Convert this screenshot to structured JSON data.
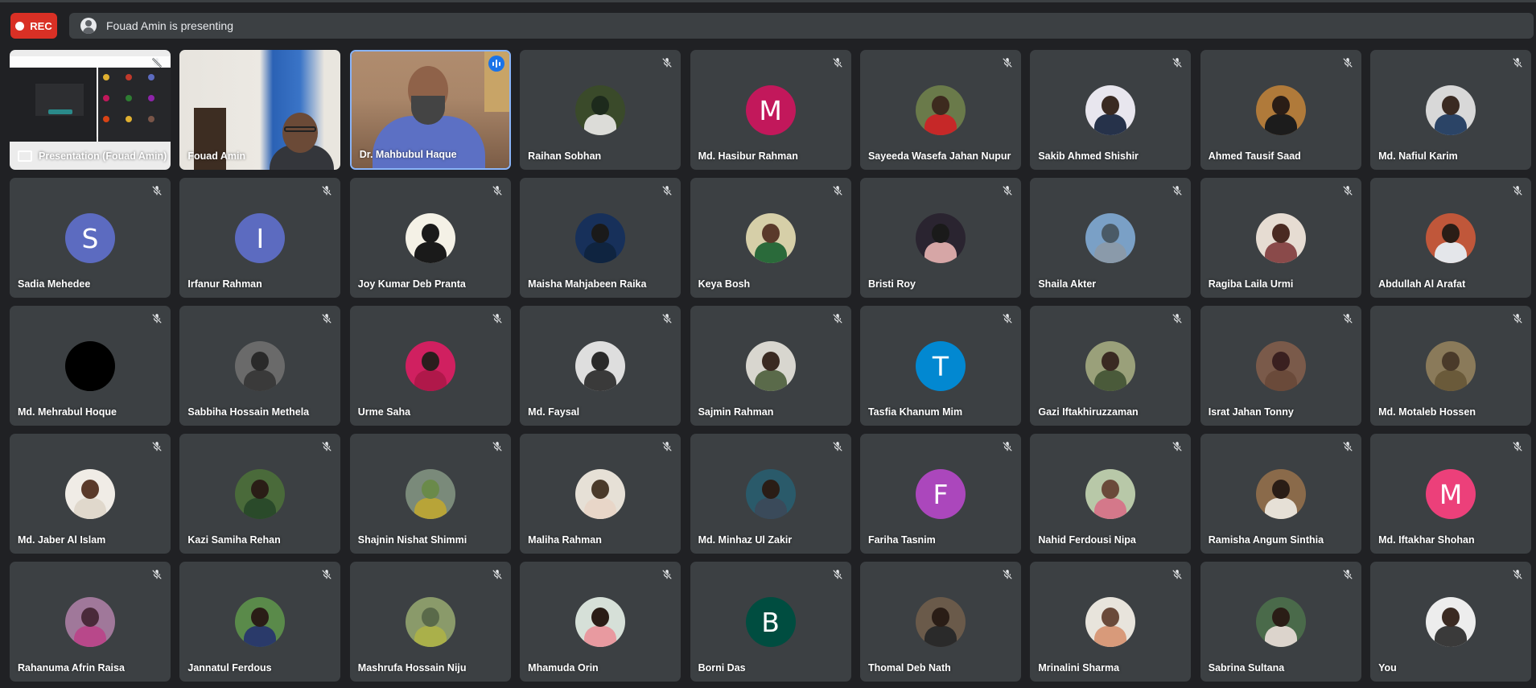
{
  "rec_label": "REC",
  "presenting_text": "Fouad Amin is presenting",
  "colors": {
    "rec_bg": "#d93025",
    "tile_bg": "#3c4043",
    "page_bg": "#202124",
    "speaking_border": "#8ab4f8"
  },
  "tiles": [
    {
      "name": "Presentation (Fouad Amin)",
      "kind": "presentation"
    },
    {
      "name": "Fouad Amin",
      "kind": "video-fouad"
    },
    {
      "name": "Dr. Mahbubul Haque",
      "kind": "video-mahbubul",
      "speaking": true
    },
    {
      "name": "Raihan Sobhan",
      "kind": "photo",
      "c1": "#1d2a1c",
      "c2": "#dcdcd8",
      "bg": "#3a4a2a"
    },
    {
      "name": "Md. Hasibur Rahman",
      "kind": "letter",
      "letter": "M",
      "color": "#c2185b"
    },
    {
      "name": "Sayeeda Wasefa Jahan Nupur",
      "kind": "photo",
      "c1": "#3d2a1e",
      "c2": "#c62828",
      "bg": "#6a7a4a"
    },
    {
      "name": "Sakib Ahmed Shishir",
      "kind": "photo",
      "c1": "#3a2a22",
      "c2": "#26324a",
      "bg": "#e8e6ee"
    },
    {
      "name": "Ahmed Tausif Saad",
      "kind": "photo",
      "c1": "#2a1d16",
      "c2": "#1c1c1c",
      "bg": "#b07a3a"
    },
    {
      "name": "Md. Nafiul Karim",
      "kind": "photo",
      "c1": "#3a2a22",
      "c2": "#2b4466",
      "bg": "#d8d8d8"
    },
    {
      "name": "Sadia Mehedee",
      "kind": "letter",
      "letter": "S",
      "color": "#5c6bc0"
    },
    {
      "name": "Irfanur Rahman",
      "kind": "letter",
      "letter": "I",
      "color": "#5c6bc0"
    },
    {
      "name": "Joy Kumar Deb Pranta",
      "kind": "photo",
      "c1": "#1a1a1a",
      "c2": "#1a1a1a",
      "bg": "#f4f1e6"
    },
    {
      "name": "Maisha Mahjabeen Raika",
      "kind": "photo",
      "c1": "#1a1a1a",
      "c2": "#0f2440",
      "bg": "#17305a"
    },
    {
      "name": "Keya Bosh",
      "kind": "photo",
      "c1": "#5a3a2a",
      "c2": "#2a6a3a",
      "bg": "#d6cfa8"
    },
    {
      "name": "Bristi Roy",
      "kind": "photo",
      "c1": "#1a1a1a",
      "c2": "#d6a6a6",
      "bg": "#2a2430"
    },
    {
      "name": "Shaila Akter",
      "kind": "photo",
      "c1": "#4a5a66",
      "c2": "#8a9aaa",
      "bg": "#7aa0c6"
    },
    {
      "name": "Ragiba Laila Urmi",
      "kind": "photo",
      "c1": "#4a2a22",
      "c2": "#8a4a4a",
      "bg": "#e6dcd2"
    },
    {
      "name": "Abdullah Al Arafat",
      "kind": "photo",
      "c1": "#2a1d16",
      "c2": "#e4e6ea",
      "bg": "#c0573a"
    },
    {
      "name": "Md. Mehrabul Hoque",
      "kind": "photo",
      "c1": "#000000",
      "c2": "#000000",
      "bg": "#000000"
    },
    {
      "name": "Sabbiha Hossain Methela",
      "kind": "photo",
      "c1": "#2a2a2a",
      "c2": "#3a3a3a",
      "bg": "#6a6a6a"
    },
    {
      "name": "Urme Saha",
      "kind": "photo",
      "c1": "#2a1d1d",
      "c2": "#b0184a",
      "bg": "#d02060"
    },
    {
      "name": "Md. Faysal",
      "kind": "photo",
      "c1": "#2a2a2a",
      "c2": "#3a3a3a",
      "bg": "#dedede"
    },
    {
      "name": "Sajmin Rahman",
      "kind": "photo",
      "c1": "#3a2a22",
      "c2": "#5a6a4a",
      "bg": "#d8d6cf"
    },
    {
      "name": "Tasfia Khanum Mim",
      "kind": "letter",
      "letter": "T",
      "color": "#0288d1"
    },
    {
      "name": "Gazi Iftakhiruzzaman",
      "kind": "photo",
      "c1": "#3a2a22",
      "c2": "#4a5a3a",
      "bg": "#9aa07a"
    },
    {
      "name": "Israt Jahan Tonny",
      "kind": "photo",
      "c1": "#3a2020",
      "c2": "#6a4a3a",
      "bg": "#7a5a4a"
    },
    {
      "name": "Md. Motaleb Hossen",
      "kind": "photo",
      "c1": "#4a3a2a",
      "c2": "#6a5a3a",
      "bg": "#8a7a5a"
    },
    {
      "name": "Md. Jaber Al Islam",
      "kind": "photo",
      "c1": "#5a3a2a",
      "c2": "#e0d8cc",
      "bg": "#f0ece6"
    },
    {
      "name": "Kazi Samiha Rehan",
      "kind": "photo",
      "c1": "#2a1d16",
      "c2": "#2a4a2a",
      "bg": "#4a6a3a"
    },
    {
      "name": "Shajnin Nishat Shimmi",
      "kind": "photo",
      "c1": "#6a8a4a",
      "c2": "#b8a438",
      "bg": "#7a8a7a"
    },
    {
      "name": "Maliha Rahman",
      "kind": "photo",
      "c1": "#4a3a2a",
      "c2": "#e8d6c8",
      "bg": "#e6e0d6"
    },
    {
      "name": "Md. Minhaz Ul Zakir",
      "kind": "photo",
      "c1": "#2a1d16",
      "c2": "#3a4a5a",
      "bg": "#2a5a6a"
    },
    {
      "name": "Fariha Tasnim",
      "kind": "letter",
      "letter": "F",
      "color": "#ab47bc"
    },
    {
      "name": "Nahid Ferdousi Nipa",
      "kind": "photo",
      "c1": "#6a4a3a",
      "c2": "#d4788a",
      "bg": "#b8c8a8"
    },
    {
      "name": "Ramisha Angum Sinthia",
      "kind": "photo",
      "c1": "#2a1d16",
      "c2": "#e6e0d6",
      "bg": "#8a6a4a"
    },
    {
      "name": "Md. Iftakhar Shohan",
      "kind": "letter",
      "letter": "M",
      "color": "#ec407a"
    },
    {
      "name": "Rahanuma Afrin Raisa",
      "kind": "photo",
      "c1": "#4a2a3a",
      "c2": "#b8488a",
      "bg": "#a0789a"
    },
    {
      "name": "Jannatul Ferdous",
      "kind": "photo",
      "c1": "#2a1d16",
      "c2": "#2a3a6a",
      "bg": "#5a8a4a"
    },
    {
      "name": "Mashrufa Hossain Niju",
      "kind": "photo",
      "c1": "#5a6a4a",
      "c2": "#aab04a",
      "bg": "#8a9a6a"
    },
    {
      "name": "Mhamuda Orin",
      "kind": "photo",
      "c1": "#2a1d16",
      "c2": "#e89aa0",
      "bg": "#d6e0d8"
    },
    {
      "name": "Borni Das",
      "kind": "letter",
      "letter": "B",
      "color": "#004d40"
    },
    {
      "name": "Thomal Deb Nath",
      "kind": "photo",
      "c1": "#2a1d16",
      "c2": "#2a2a2a",
      "bg": "#6a5a4a"
    },
    {
      "name": "Mrinalini Sharma",
      "kind": "photo",
      "c1": "#6a4a3a",
      "c2": "#d89a7a",
      "bg": "#e8e4dc"
    },
    {
      "name": "Sabrina Sultana",
      "kind": "photo",
      "c1": "#2a1d16",
      "c2": "#dcd4cc",
      "bg": "#4a6a4a"
    },
    {
      "name": "You",
      "kind": "photo",
      "c1": "#3a2a22",
      "c2": "#3a3a3a",
      "bg": "#ededed"
    }
  ]
}
